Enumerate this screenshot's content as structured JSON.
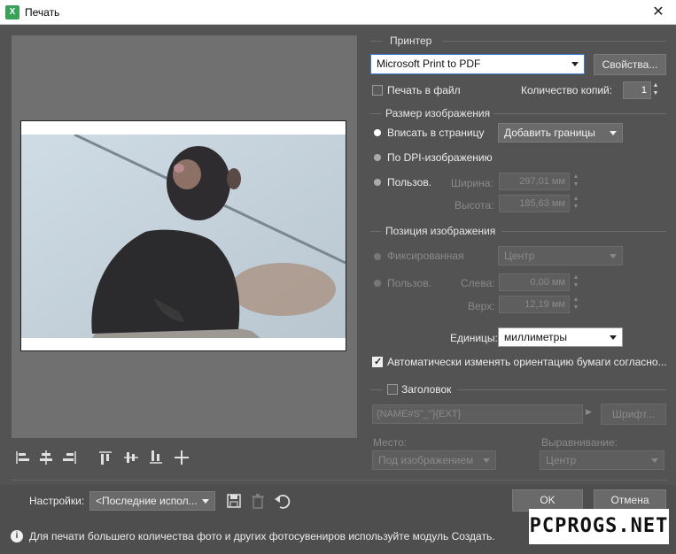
{
  "window": {
    "title": "Печать",
    "app_icon": "app-logo-icon",
    "close_glyph": "✕"
  },
  "printer": {
    "section_label": "Принтер",
    "selected": "Microsoft Print to PDF",
    "properties_button": "Свойства...",
    "print_to_file_label": "Печать в файл",
    "print_to_file_checked": false,
    "copies_label": "Количество копий:",
    "copies_value": "1"
  },
  "image_size": {
    "section_label": "Размер изображения",
    "fit_page_label": "Вписать в страницу",
    "fit_page_selected": true,
    "fit_mode_value": "Добавить границы",
    "by_dpi_label": "По DPI-изображению",
    "custom_label": "Пользов.",
    "width_label": "Ширина:",
    "width_value": "297,01 мм",
    "height_label": "Высота:",
    "height_value": "185,63 мм"
  },
  "image_position": {
    "section_label": "Позиция изображения",
    "fixed_label": "Фиксированная",
    "fixed_value": "Центр",
    "custom_label": "Пользов.",
    "left_label": "Слева:",
    "left_value": "0,00 мм",
    "top_label": "Верх:",
    "top_value": "12,19 мм"
  },
  "units": {
    "label": "Единицы:",
    "value": "миллиметры"
  },
  "auto_orient": {
    "label": "Автоматически изменять ориентацию бумаги согласно...",
    "checked": true
  },
  "header": {
    "label": "Заголовок",
    "checked": false,
    "template": "{NAME#S\"_\"}{EXT}",
    "font_button": "Шрифт...",
    "place_label": "Место:",
    "place_value": "Под изображением",
    "align_label": "Выравнивание:",
    "align_value": "Центр"
  },
  "align_toolbar": [
    "align-left-icon",
    "align-center-h-icon",
    "align-right-icon",
    "align-top-icon",
    "align-center-v-icon",
    "align-bottom-icon",
    "align-center-icon"
  ],
  "settings": {
    "label": "Настройки:",
    "value": "<Последние испол...",
    "save_icon": "save-icon",
    "delete_icon": "trash-icon",
    "undo_icon": "undo-icon"
  },
  "buttons": {
    "ok": "OK",
    "cancel": "Отмена"
  },
  "info": {
    "text": "Для печати большего количества фото и других фотосувениров используйте модуль Создать."
  },
  "watermark": "PCPROGS.NET"
}
